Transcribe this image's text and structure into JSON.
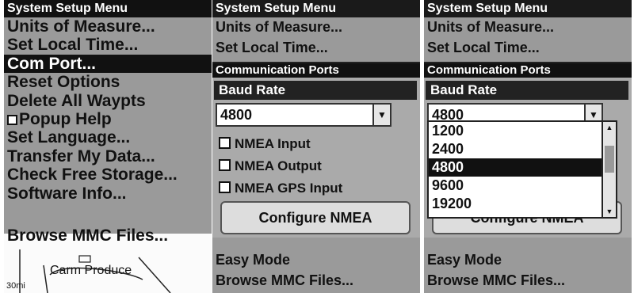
{
  "screen1": {
    "title": "System Setup Menu",
    "items": [
      "Units of Measure...",
      "Set Local Time...",
      "Com Port...",
      "Reset Options",
      "Delete All Waypts",
      "Popup Help",
      "Set Language...",
      "Transfer My Data...",
      "Check Free Storage...",
      "Software Info..."
    ],
    "selected_index": 2,
    "cut_item": "Browse MMC Files...",
    "map_label": "Carm Produce",
    "map_scale": "30mi"
  },
  "screen2": {
    "title": "System Setup Menu",
    "items": [
      "Units of Measure...",
      "Set Local Time..."
    ],
    "dialog_title": "Communication Ports",
    "field_label": "Baud Rate",
    "field_value": "4800",
    "checks": [
      "NMEA Input",
      "NMEA Output",
      "NMEA GPS Input"
    ],
    "button": "Configure NMEA",
    "bottom_items": [
      "Easy Mode",
      "Browse MMC Files..."
    ]
  },
  "screen3": {
    "title": "System Setup Menu",
    "items": [
      "Units of Measure...",
      "Set Local Time..."
    ],
    "dialog_title": "Communication Ports",
    "field_label": "Baud Rate",
    "field_value": "4800",
    "options": [
      "1200",
      "2400",
      "4800",
      "9600",
      "19200"
    ],
    "selected_option": "4800",
    "button": "Configure NMEA",
    "bottom_items": [
      "Easy Mode",
      "Browse MMC Files..."
    ]
  }
}
